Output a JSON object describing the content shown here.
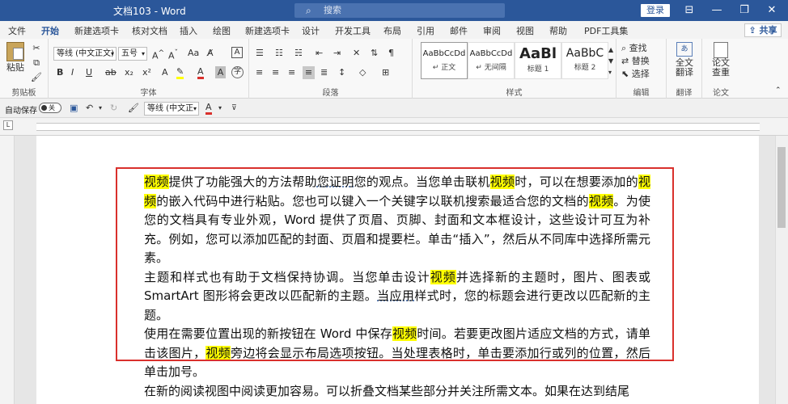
{
  "window": {
    "title": "文档103 - Word",
    "search_placeholder": "搜索",
    "login_label": "登录",
    "minimize": "—",
    "restore": "❐",
    "ribbon_display": "⊟"
  },
  "tabs": [
    "文件",
    "开始",
    "新建选项卡",
    "核对文档",
    "插入",
    "绘图",
    "新建选项卡",
    "设计",
    "开发工具",
    "布局",
    "引用",
    "邮件",
    "审阅",
    "视图",
    "帮助",
    "PDF工具集"
  ],
  "share_label": "共享",
  "ribbon": {
    "clipboard": {
      "label": "剪贴板",
      "paste": "粘贴"
    },
    "font": {
      "label": "字体",
      "font_name": "等线 (中文正文)",
      "font_size": "五号",
      "buttons": [
        "B",
        "I",
        "U",
        "ab",
        "x₂",
        "x²"
      ]
    },
    "paragraph": {
      "label": "段落"
    },
    "styles": {
      "label": "样式",
      "items": [
        {
          "sample": "AaBbCcDd",
          "name": "↵ 正文"
        },
        {
          "sample": "AaBbCcDd",
          "name": "↵ 无间隔"
        },
        {
          "sample": "AaBl",
          "name": "标题 1"
        },
        {
          "sample": "AaBbC",
          "name": "标题 2"
        }
      ]
    },
    "editing": {
      "label": "编辑",
      "find": "查找",
      "replace": "替换",
      "select": "选择"
    },
    "translate": {
      "label": "翻译",
      "full_text": "全文",
      "translate": "翻译"
    },
    "paper": {
      "label": "论文",
      "line1": "论文",
      "line2": "查重"
    }
  },
  "qat": {
    "autosave": "自动保存",
    "toggle": "关",
    "font_name": "等线 (中文正"
  },
  "document": {
    "p1": [
      {
        "t": "视频",
        "hl": true
      },
      {
        "t": "提供了功能强大的方法帮助"
      },
      {
        "t": "您证明",
        "ul": true
      },
      {
        "t": "您的观点。当您单击联机"
      },
      {
        "t": "视频",
        "hl": true
      },
      {
        "t": "时，可以在想要添加的"
      },
      {
        "t": "视频",
        "hl": true
      },
      {
        "t": "的嵌入代码中进行粘贴。您也可以键入一个关键字以联机搜索最适合您的文档的"
      },
      {
        "t": "视频",
        "hl": true
      },
      {
        "t": "。为使您的文档具有专业外观，Word 提供了页眉、页脚、封面和文本框设计，这些设计可互为补充。例如，您可以添加匹配的封面、页眉和提要栏。单击“插入”，然后从不同库中选择所需元素。"
      }
    ],
    "p2": [
      {
        "t": "主题和样式也有助于文档保持协调。当您单击设计"
      },
      {
        "t": "视频",
        "hl": true
      },
      {
        "t": "并选择新的主题时，图片、图表或 SmartArt 图形将会更改以匹配新的主题。"
      },
      {
        "t": "当应用",
        "ul": true
      },
      {
        "t": "样式时，您的标题会进行更改以匹配新的主题。"
      }
    ],
    "p3": [
      {
        "t": "使用在需要位置出现的新按钮在 Word 中保存"
      },
      {
        "t": "视频",
        "hl": true
      },
      {
        "t": "时间。若要更改图片适应文档的方式，请单击该图片，"
      },
      {
        "t": "视频",
        "hl": true
      },
      {
        "t": "旁边将会显示布局选项按钮。当处理表格时，单击要添加行或列的位置，然后单击加号。"
      }
    ],
    "p4": [
      {
        "t": "在新的阅读视图中阅读更加容易。可以折叠文档某些部分并关注所需文本。如果在达到结尾"
      }
    ]
  }
}
